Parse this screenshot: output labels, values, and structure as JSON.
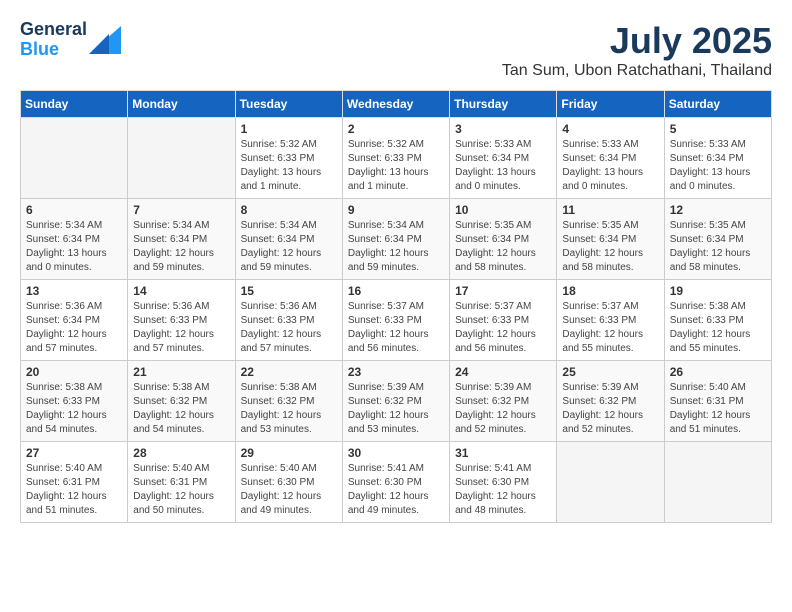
{
  "header": {
    "logo_line1": "General",
    "logo_line2": "Blue",
    "title": "July 2025",
    "subtitle": "Tan Sum, Ubon Ratchathani, Thailand"
  },
  "calendar": {
    "weekdays": [
      "Sunday",
      "Monday",
      "Tuesday",
      "Wednesday",
      "Thursday",
      "Friday",
      "Saturday"
    ],
    "weeks": [
      [
        {
          "day": "",
          "info": ""
        },
        {
          "day": "",
          "info": ""
        },
        {
          "day": "1",
          "info": "Sunrise: 5:32 AM\nSunset: 6:33 PM\nDaylight: 13 hours and 1 minute."
        },
        {
          "day": "2",
          "info": "Sunrise: 5:32 AM\nSunset: 6:33 PM\nDaylight: 13 hours and 1 minute."
        },
        {
          "day": "3",
          "info": "Sunrise: 5:33 AM\nSunset: 6:34 PM\nDaylight: 13 hours and 0 minutes."
        },
        {
          "day": "4",
          "info": "Sunrise: 5:33 AM\nSunset: 6:34 PM\nDaylight: 13 hours and 0 minutes."
        },
        {
          "day": "5",
          "info": "Sunrise: 5:33 AM\nSunset: 6:34 PM\nDaylight: 13 hours and 0 minutes."
        }
      ],
      [
        {
          "day": "6",
          "info": "Sunrise: 5:34 AM\nSunset: 6:34 PM\nDaylight: 13 hours and 0 minutes."
        },
        {
          "day": "7",
          "info": "Sunrise: 5:34 AM\nSunset: 6:34 PM\nDaylight: 12 hours and 59 minutes."
        },
        {
          "day": "8",
          "info": "Sunrise: 5:34 AM\nSunset: 6:34 PM\nDaylight: 12 hours and 59 minutes."
        },
        {
          "day": "9",
          "info": "Sunrise: 5:34 AM\nSunset: 6:34 PM\nDaylight: 12 hours and 59 minutes."
        },
        {
          "day": "10",
          "info": "Sunrise: 5:35 AM\nSunset: 6:34 PM\nDaylight: 12 hours and 58 minutes."
        },
        {
          "day": "11",
          "info": "Sunrise: 5:35 AM\nSunset: 6:34 PM\nDaylight: 12 hours and 58 minutes."
        },
        {
          "day": "12",
          "info": "Sunrise: 5:35 AM\nSunset: 6:34 PM\nDaylight: 12 hours and 58 minutes."
        }
      ],
      [
        {
          "day": "13",
          "info": "Sunrise: 5:36 AM\nSunset: 6:34 PM\nDaylight: 12 hours and 57 minutes."
        },
        {
          "day": "14",
          "info": "Sunrise: 5:36 AM\nSunset: 6:33 PM\nDaylight: 12 hours and 57 minutes."
        },
        {
          "day": "15",
          "info": "Sunrise: 5:36 AM\nSunset: 6:33 PM\nDaylight: 12 hours and 57 minutes."
        },
        {
          "day": "16",
          "info": "Sunrise: 5:37 AM\nSunset: 6:33 PM\nDaylight: 12 hours and 56 minutes."
        },
        {
          "day": "17",
          "info": "Sunrise: 5:37 AM\nSunset: 6:33 PM\nDaylight: 12 hours and 56 minutes."
        },
        {
          "day": "18",
          "info": "Sunrise: 5:37 AM\nSunset: 6:33 PM\nDaylight: 12 hours and 55 minutes."
        },
        {
          "day": "19",
          "info": "Sunrise: 5:38 AM\nSunset: 6:33 PM\nDaylight: 12 hours and 55 minutes."
        }
      ],
      [
        {
          "day": "20",
          "info": "Sunrise: 5:38 AM\nSunset: 6:33 PM\nDaylight: 12 hours and 54 minutes."
        },
        {
          "day": "21",
          "info": "Sunrise: 5:38 AM\nSunset: 6:32 PM\nDaylight: 12 hours and 54 minutes."
        },
        {
          "day": "22",
          "info": "Sunrise: 5:38 AM\nSunset: 6:32 PM\nDaylight: 12 hours and 53 minutes."
        },
        {
          "day": "23",
          "info": "Sunrise: 5:39 AM\nSunset: 6:32 PM\nDaylight: 12 hours and 53 minutes."
        },
        {
          "day": "24",
          "info": "Sunrise: 5:39 AM\nSunset: 6:32 PM\nDaylight: 12 hours and 52 minutes."
        },
        {
          "day": "25",
          "info": "Sunrise: 5:39 AM\nSunset: 6:32 PM\nDaylight: 12 hours and 52 minutes."
        },
        {
          "day": "26",
          "info": "Sunrise: 5:40 AM\nSunset: 6:31 PM\nDaylight: 12 hours and 51 minutes."
        }
      ],
      [
        {
          "day": "27",
          "info": "Sunrise: 5:40 AM\nSunset: 6:31 PM\nDaylight: 12 hours and 51 minutes."
        },
        {
          "day": "28",
          "info": "Sunrise: 5:40 AM\nSunset: 6:31 PM\nDaylight: 12 hours and 50 minutes."
        },
        {
          "day": "29",
          "info": "Sunrise: 5:40 AM\nSunset: 6:30 PM\nDaylight: 12 hours and 49 minutes."
        },
        {
          "day": "30",
          "info": "Sunrise: 5:41 AM\nSunset: 6:30 PM\nDaylight: 12 hours and 49 minutes."
        },
        {
          "day": "31",
          "info": "Sunrise: 5:41 AM\nSunset: 6:30 PM\nDaylight: 12 hours and 48 minutes."
        },
        {
          "day": "",
          "info": ""
        },
        {
          "day": "",
          "info": ""
        }
      ]
    ]
  }
}
